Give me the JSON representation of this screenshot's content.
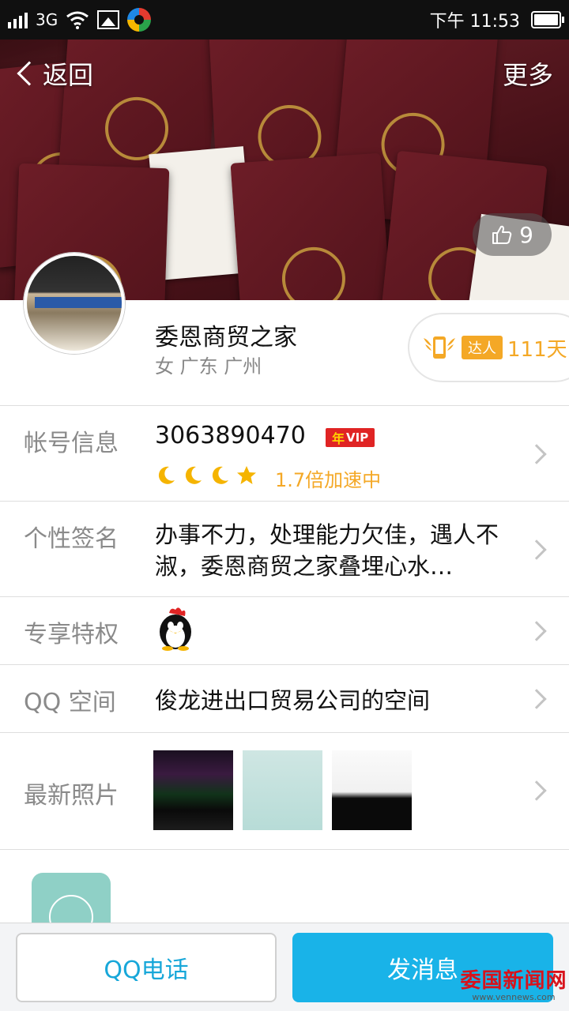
{
  "status_bar": {
    "network": "3G",
    "time": "下午 11:53"
  },
  "nav": {
    "back_label": "返回",
    "more_label": "更多"
  },
  "cover": {
    "likes": "9"
  },
  "profile": {
    "nickname": "委恩商贸之家",
    "location": "女 广东 广州",
    "daren_tag": "达人",
    "daren_days": "111天"
  },
  "account": {
    "label": "帐号信息",
    "number": "3063890470",
    "vip_year": "年",
    "vip_text": "VIP",
    "speed": "1.7倍加速中"
  },
  "signature": {
    "label": "个性签名",
    "text": "办事不力，处理能力欠佳，遇人不淑，委恩商贸之家叠埋心水…"
  },
  "privileges": {
    "label": "专享特权"
  },
  "qzone": {
    "label": "QQ 空间",
    "text": "俊龙进出口贸易公司的空间"
  },
  "photos": {
    "label": "最新照片"
  },
  "actions": {
    "call_label": "QQ电话",
    "message_label": "发消息"
  },
  "watermark": {
    "title": "委国新闻网",
    "url": "www.vennews.com"
  },
  "colors": {
    "accent_blue": "#19b3e8",
    "gold": "#f4a826",
    "vip_red": "#e02424"
  }
}
